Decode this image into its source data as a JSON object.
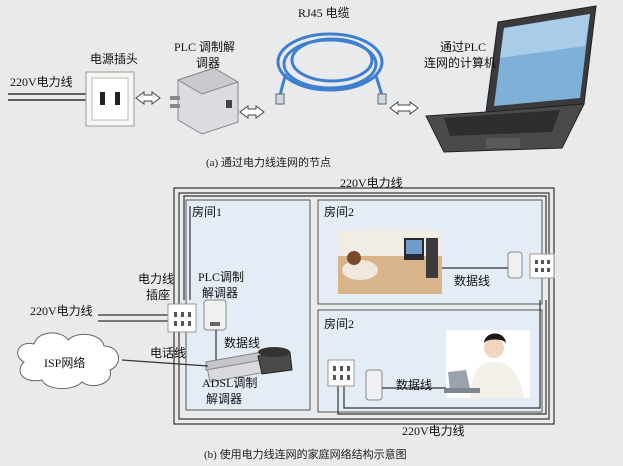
{
  "part_a": {
    "label_220v": "220V电力线",
    "label_outlet": "电源插头",
    "label_plc_line1": "PLC 调制解",
    "label_plc_line2": "调器",
    "label_rj45": "RJ45 电缆",
    "label_computer_line1": "通过PLC",
    "label_computer_line2": "连网的计算机",
    "caption": "(a)  通过电力线连网的节点"
  },
  "part_b": {
    "label_220v_top": "220V电力线",
    "room1": "房间1",
    "room2_top": "房间2",
    "room2_bottom": "房间2",
    "label_socket_line1": "电力线",
    "label_socket_line2": "插座",
    "label_plc_line1": "PLC调制",
    "label_plc_line2": "解调器",
    "label_220v_left": "220V电力线",
    "label_phone_line": "电话线",
    "label_isp": "ISP网络",
    "label_data_line_left": "数据线",
    "label_adsl_line1": "ADSL调制",
    "label_adsl_line2": "解调器",
    "label_data_line_top": "数据线",
    "label_data_line_bottom": "数据线",
    "label_220v_bottom": "220V电力线",
    "caption": "(b)  使用电力线连网的家庭网络结构示意图"
  },
  "colors": {
    "background": "#e9eaec",
    "room_fill": "#e4ecf6",
    "cable_blue": "#3f7fd0",
    "wire": "#333333"
  }
}
